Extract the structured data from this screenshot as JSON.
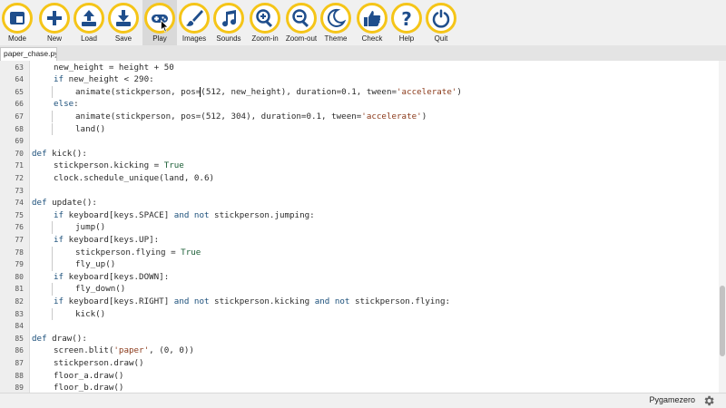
{
  "toolbar": {
    "accent_color": "#f5c518",
    "icon_color": "#1f4e8c",
    "buttons": [
      {
        "id": "mode",
        "label": "Mode",
        "icon": "mode-icon"
      },
      {
        "id": "new",
        "label": "New",
        "icon": "plus-icon"
      },
      {
        "id": "load",
        "label": "Load",
        "icon": "upload-icon"
      },
      {
        "id": "save",
        "label": "Save",
        "icon": "download-icon"
      },
      {
        "id": "play",
        "label": "Play",
        "icon": "gamepad-icon",
        "active": true
      },
      {
        "id": "images",
        "label": "Images",
        "icon": "brush-icon"
      },
      {
        "id": "sounds",
        "label": "Sounds",
        "icon": "music-icon"
      },
      {
        "id": "zoom-in",
        "label": "Zoom-in",
        "icon": "zoom-in-icon"
      },
      {
        "id": "zoom-out",
        "label": "Zoom-out",
        "icon": "zoom-out-icon"
      },
      {
        "id": "theme",
        "label": "Theme",
        "icon": "moon-icon"
      },
      {
        "id": "check",
        "label": "Check",
        "icon": "thumbs-up-icon"
      },
      {
        "id": "help",
        "label": "Help",
        "icon": "question-icon"
      },
      {
        "id": "quit",
        "label": "Quit",
        "icon": "power-icon"
      }
    ]
  },
  "tab": {
    "label": "paper_chase.py"
  },
  "editor": {
    "lines": [
      {
        "n": "63",
        "indent": 1,
        "toks": [
          [
            "t",
            "new_height = height + 50"
          ]
        ]
      },
      {
        "n": "64",
        "indent": 1,
        "toks": [
          [
            "k",
            "if"
          ],
          [
            "t",
            " new_height < 290:"
          ]
        ]
      },
      {
        "n": "65",
        "indent": 2,
        "toks": [
          [
            "t",
            "animate(stickperson, pos=(512, new_height), duration=0.1, tween="
          ],
          [
            "s",
            "'accelerate'"
          ],
          [
            "t",
            ")"
          ]
        ]
      },
      {
        "n": "66",
        "indent": 1,
        "toks": [
          [
            "k",
            "else"
          ],
          [
            "t",
            ":"
          ]
        ]
      },
      {
        "n": "67",
        "indent": 2,
        "toks": [
          [
            "t",
            "animate(stickperson, pos=(512, 304), duration=0.1, tween="
          ],
          [
            "s",
            "'accelerate'"
          ],
          [
            "t",
            ")"
          ]
        ]
      },
      {
        "n": "68",
        "indent": 2,
        "toks": [
          [
            "t",
            "land()"
          ]
        ]
      },
      {
        "n": "69",
        "indent": 0,
        "toks": []
      },
      {
        "n": "70",
        "indent": 0,
        "toks": [
          [
            "k",
            "def"
          ],
          [
            "t",
            " kick():"
          ]
        ]
      },
      {
        "n": "71",
        "indent": 1,
        "toks": [
          [
            "t",
            "stickperson.kicking = "
          ],
          [
            "b",
            "True"
          ]
        ]
      },
      {
        "n": "72",
        "indent": 1,
        "toks": [
          [
            "t",
            "clock.schedule_unique(land, 0.6)"
          ]
        ]
      },
      {
        "n": "73",
        "indent": 0,
        "toks": []
      },
      {
        "n": "74",
        "indent": 0,
        "toks": [
          [
            "k",
            "def"
          ],
          [
            "t",
            " update():"
          ]
        ]
      },
      {
        "n": "75",
        "indent": 1,
        "toks": [
          [
            "k",
            "if"
          ],
          [
            "t",
            " keyboard[keys.SPACE] "
          ],
          [
            "k",
            "and not"
          ],
          [
            "t",
            " stickperson.jumping:"
          ]
        ]
      },
      {
        "n": "76",
        "indent": 2,
        "toks": [
          [
            "t",
            "jump()"
          ]
        ]
      },
      {
        "n": "77",
        "indent": 1,
        "toks": [
          [
            "k",
            "if"
          ],
          [
            "t",
            " keyboard[keys.UP]:"
          ]
        ]
      },
      {
        "n": "78",
        "indent": 2,
        "toks": [
          [
            "t",
            "stickperson.flying = "
          ],
          [
            "b",
            "True"
          ]
        ]
      },
      {
        "n": "79",
        "indent": 2,
        "toks": [
          [
            "t",
            "fly_up()"
          ]
        ]
      },
      {
        "n": "80",
        "indent": 1,
        "toks": [
          [
            "k",
            "if"
          ],
          [
            "t",
            " keyboard[keys.DOWN]:"
          ]
        ]
      },
      {
        "n": "81",
        "indent": 2,
        "toks": [
          [
            "t",
            "fly_down()"
          ]
        ]
      },
      {
        "n": "82",
        "indent": 1,
        "toks": [
          [
            "k",
            "if"
          ],
          [
            "t",
            " keyboard[keys.RIGHT] "
          ],
          [
            "k",
            "and not"
          ],
          [
            "t",
            " stickperson.kicking "
          ],
          [
            "k",
            "and not"
          ],
          [
            "t",
            " stickperson.flying:"
          ]
        ]
      },
      {
        "n": "83",
        "indent": 2,
        "toks": [
          [
            "t",
            "kick()"
          ]
        ]
      },
      {
        "n": "84",
        "indent": 0,
        "toks": []
      },
      {
        "n": "85",
        "indent": 0,
        "toks": [
          [
            "k",
            "def"
          ],
          [
            "t",
            " draw():"
          ]
        ]
      },
      {
        "n": "86",
        "indent": 1,
        "toks": [
          [
            "t",
            "screen.blit("
          ],
          [
            "s",
            "'paper'"
          ],
          [
            "t",
            ", (0, 0))"
          ]
        ]
      },
      {
        "n": "87",
        "indent": 1,
        "toks": [
          [
            "t",
            "stickperson.draw()"
          ]
        ]
      },
      {
        "n": "88",
        "indent": 1,
        "toks": [
          [
            "t",
            "floor_a.draw()"
          ]
        ]
      },
      {
        "n": "89",
        "indent": 1,
        "toks": [
          [
            "t",
            "floor_b.draw()"
          ]
        ]
      }
    ]
  },
  "status": {
    "mode": "Pygamezero",
    "settings_icon": "gear-icon"
  }
}
